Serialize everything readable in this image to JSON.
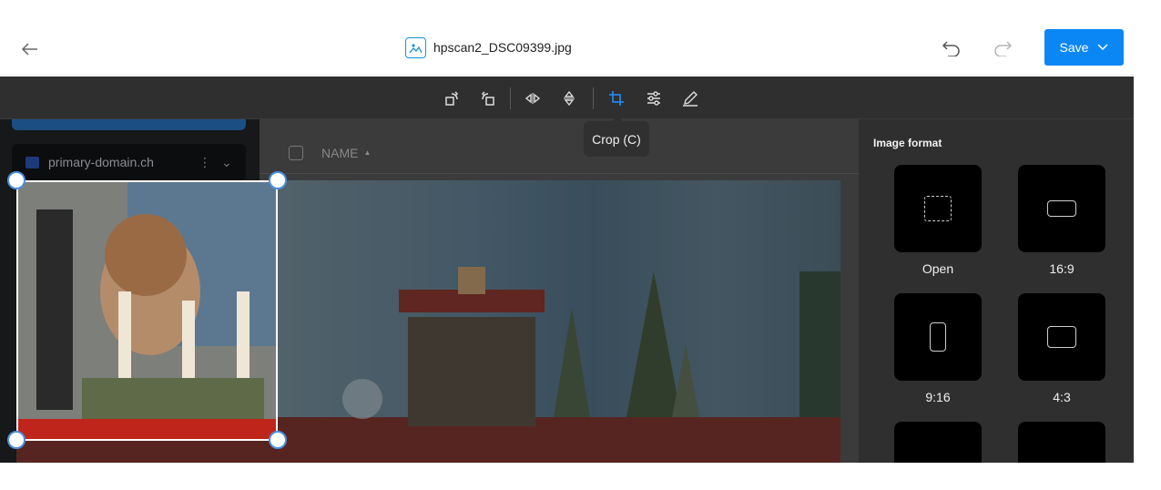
{
  "header": {
    "file_name": "hpscan2_DSC09399.jpg",
    "save_label": "Save"
  },
  "toolbar": {
    "tools": [
      "rotate-left",
      "rotate-right",
      "flip-horizontal",
      "flip-vertical",
      "crop",
      "adjust",
      "annotate"
    ],
    "active_tool": "crop",
    "tooltip": "Crop (C)"
  },
  "background_ui": {
    "domain_name": "primary-domain.ch",
    "column_header": "NAME"
  },
  "panel": {
    "title": "Image format",
    "formats": [
      {
        "label": "Open"
      },
      {
        "label": "16:9"
      },
      {
        "label": "9:16"
      },
      {
        "label": "4:3"
      },
      {
        "label": ""
      },
      {
        "label": ""
      }
    ]
  },
  "colors": {
    "accent": "#0b87f5",
    "toolbar_bg": "#2f2f2f",
    "panel_bg": "#2f2f2f"
  }
}
